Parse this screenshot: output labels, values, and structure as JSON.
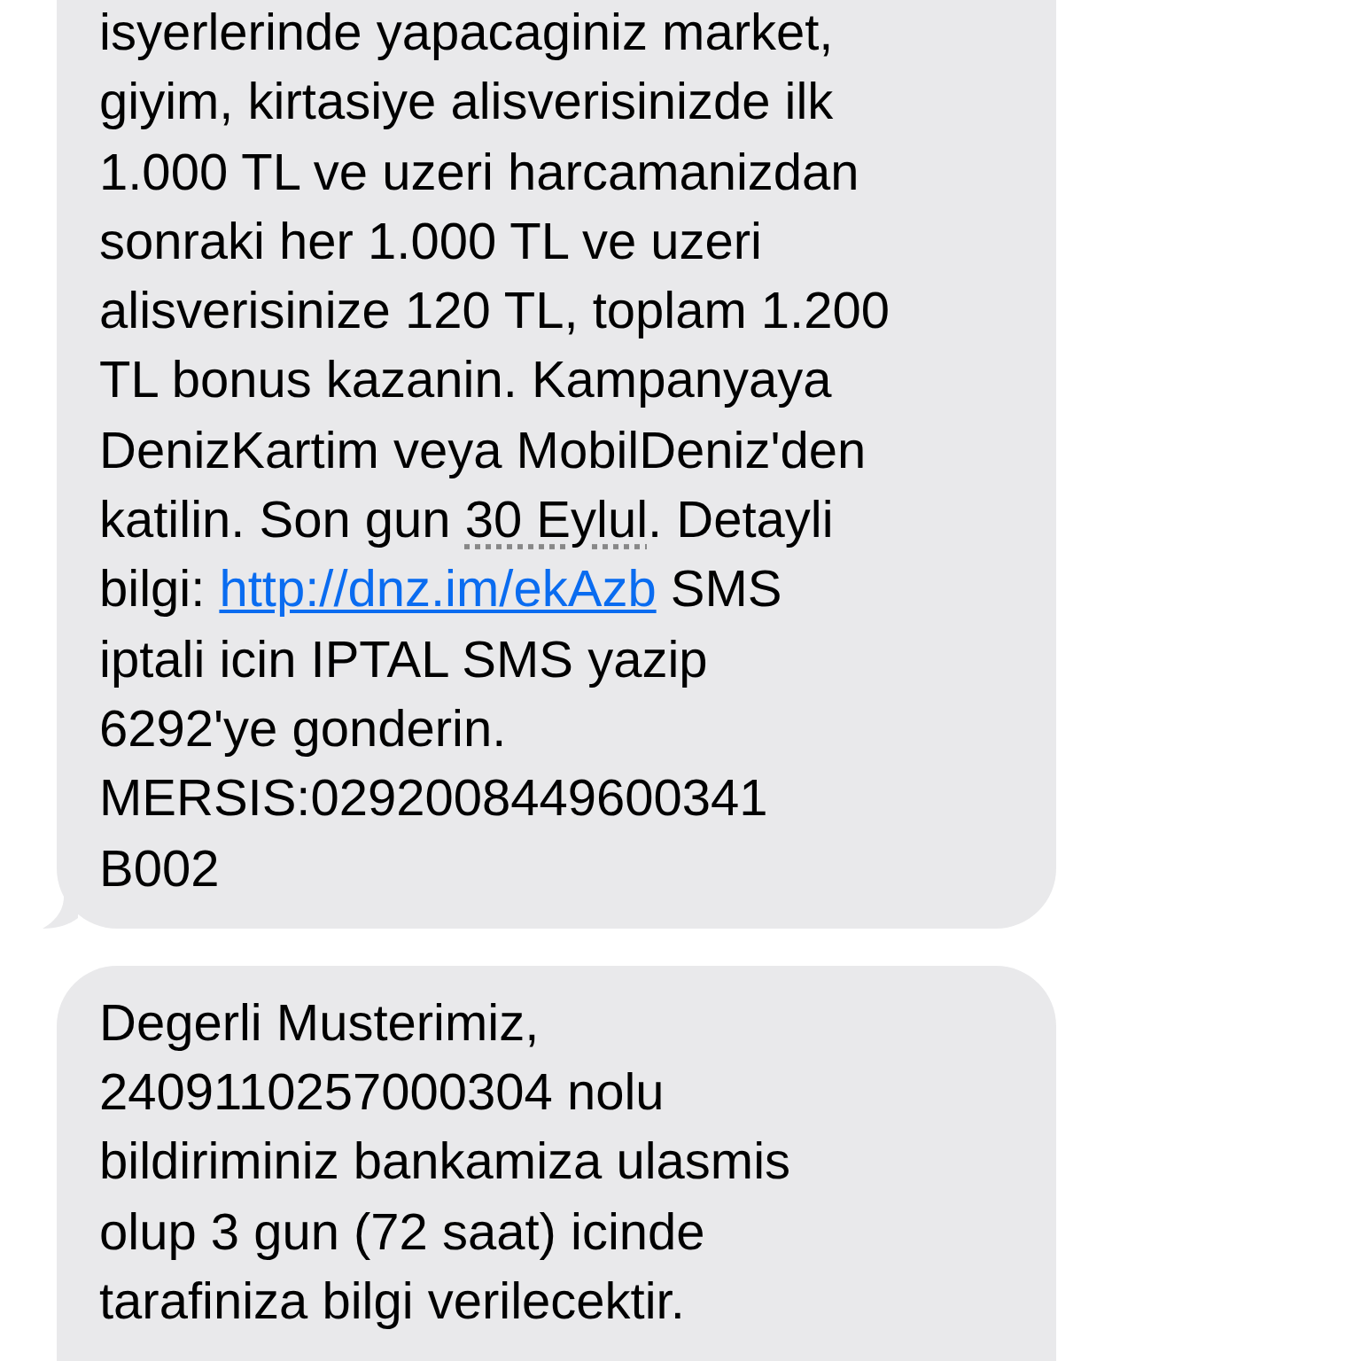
{
  "messages": [
    {
      "tail": true,
      "lines": [
        [
          {
            "kind": "text",
            "text": "isyerlerinde yapacaginiz market,"
          }
        ],
        [
          {
            "kind": "text",
            "text": "giyim, kirtasiye alisverisinizde ilk"
          }
        ],
        [
          {
            "kind": "text",
            "text": "1.000 TL ve uzeri harcamanizdan"
          }
        ],
        [
          {
            "kind": "text",
            "text": "sonraki her 1.000 TL ve uzeri"
          }
        ],
        [
          {
            "kind": "text",
            "text": "alisverisinize 120 TL, toplam 1.200"
          }
        ],
        [
          {
            "kind": "text",
            "text": "TL bonus kazanin. Kampanyaya"
          }
        ],
        [
          {
            "kind": "text",
            "text": "DenizKartim veya MobilDeniz'den"
          }
        ],
        [
          {
            "kind": "text",
            "text": "katilin. Son gun "
          },
          {
            "kind": "date",
            "text": "30 Eylul"
          },
          {
            "kind": "text",
            "text": ". Detayli"
          }
        ],
        [
          {
            "kind": "text",
            "text": "bilgi: "
          },
          {
            "kind": "link",
            "text": "http://dnz.im/ekAzb"
          },
          {
            "kind": "text",
            "text": " SMS"
          }
        ],
        [
          {
            "kind": "text",
            "text": "iptali icin IPTAL SMS yazip"
          }
        ],
        [
          {
            "kind": "text",
            "text": "6292'ye gonderin."
          }
        ],
        [
          {
            "kind": "text",
            "text": "MERSIS:0292008449600341"
          }
        ],
        [
          {
            "kind": "text",
            "text": "B002"
          }
        ]
      ]
    },
    {
      "lines": [
        [
          {
            "kind": "text",
            "text": "Degerli Musterimiz,"
          }
        ],
        [
          {
            "kind": "text",
            "text": "2409110257000304 nolu"
          }
        ],
        [
          {
            "kind": "text",
            "text": "bildiriminiz bankamiza ulasmis"
          }
        ],
        [
          {
            "kind": "text",
            "text": "olup 3 gun (72 saat) icinde"
          }
        ],
        [
          {
            "kind": "text",
            "text": "tarafiniza bilgi verilecektir."
          }
        ]
      ]
    }
  ]
}
